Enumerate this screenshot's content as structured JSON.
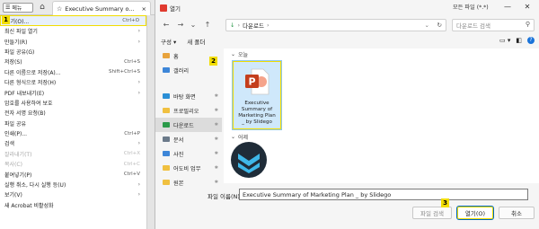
{
  "acrobat": {
    "menu_label": "메뉴",
    "tab_title": "Executive Summary o...",
    "tab_close": "×",
    "new_tab": "+"
  },
  "file_menu": {
    "items": [
      {
        "label": "열기(O)...",
        "shortcut": "Ctrl+O",
        "arrow": "",
        "disabled": false
      },
      {
        "label": "최신 파일 열기",
        "shortcut": "",
        "arrow": "›",
        "disabled": false
      },
      {
        "label": "만들기(R)",
        "shortcut": "",
        "arrow": "›",
        "disabled": false
      },
      {
        "label": "파일 공유(G)",
        "shortcut": "",
        "arrow": "",
        "disabled": false
      },
      {
        "label": "저장(S)",
        "shortcut": "Ctrl+S",
        "arrow": "",
        "disabled": false
      },
      {
        "label": "다른 이름으로 저장(A)...",
        "shortcut": "Shift+Ctrl+S",
        "arrow": "",
        "disabled": false
      },
      {
        "label": "다른 형식으로 저장(H)",
        "shortcut": "",
        "arrow": "›",
        "disabled": false
      },
      {
        "label": "PDF 내보내기(E)",
        "shortcut": "",
        "arrow": "›",
        "disabled": false
      },
      {
        "label": "암호를 사용하여 보호",
        "shortcut": "",
        "arrow": "",
        "disabled": false
      },
      {
        "label": "전자 서명 요청(B)",
        "shortcut": "",
        "arrow": "",
        "disabled": false
      },
      {
        "label": "파일 공유",
        "shortcut": "",
        "arrow": "",
        "disabled": false
      },
      {
        "label": "인쇄(P)...",
        "shortcut": "Ctrl+P",
        "arrow": "",
        "disabled": false
      },
      {
        "label": "검색",
        "shortcut": "",
        "arrow": "›",
        "disabled": false
      },
      {
        "label": "잘라내기(T)",
        "shortcut": "Ctrl+X",
        "arrow": "",
        "disabled": true
      },
      {
        "label": "복사(C)",
        "shortcut": "Ctrl+C",
        "arrow": "",
        "disabled": true
      },
      {
        "label": "붙여넣기(P)",
        "shortcut": "Ctrl+V",
        "arrow": "",
        "disabled": false
      },
      {
        "label": "실행 취소, 다시 실행 등(U)",
        "shortcut": "",
        "arrow": "›",
        "disabled": false
      },
      {
        "label": "보기(V)",
        "shortcut": "",
        "arrow": "›",
        "disabled": false
      },
      {
        "label": "새 Acrobat 비활성화",
        "shortcut": "",
        "arrow": "",
        "disabled": false
      }
    ]
  },
  "dialog": {
    "title": "열기",
    "address": "다운로드",
    "search_placeholder": "다운로드 검색",
    "organize": "구성 ▾",
    "new_folder": "새 폴더",
    "nav": [
      {
        "label": "홈",
        "color": "#e8a33d"
      },
      {
        "label": "갤러리",
        "color": "#3d86d8"
      },
      {
        "label": "바탕 화면",
        "color": "#2b8fd6"
      },
      {
        "label": "프로필리오",
        "color": "#f0c040"
      },
      {
        "label": "다운로드",
        "color": "#2b9a4a"
      },
      {
        "label": "문서",
        "color": "#6b7a8a"
      },
      {
        "label": "사진",
        "color": "#3d86d8"
      },
      {
        "label": "어도비 업무",
        "color": "#f0c040"
      },
      {
        "label": "원본",
        "color": "#f0c040"
      }
    ],
    "group_today": "오늘",
    "group_yesterday": "어제",
    "file_name_display": "Executive\nSummary of\nMarketing Plan\n_ by Slidego",
    "filename_label": "파일 이름(N):",
    "filename_value": "Executive Summary of Marketing Plan _ by Slidego",
    "filter_label": "모든 파일 (*.*)",
    "file_location_btn": "파일 검색",
    "open_btn": "열기(O)",
    "cancel_btn": "취소"
  },
  "badges": [
    "1",
    "2",
    "3"
  ],
  "colors": {
    "highlight": "#f2dd00",
    "ppt_red": "#c43e1c",
    "logo_dark": "#1f2c38",
    "logo_accent": "#3fb8e8"
  }
}
